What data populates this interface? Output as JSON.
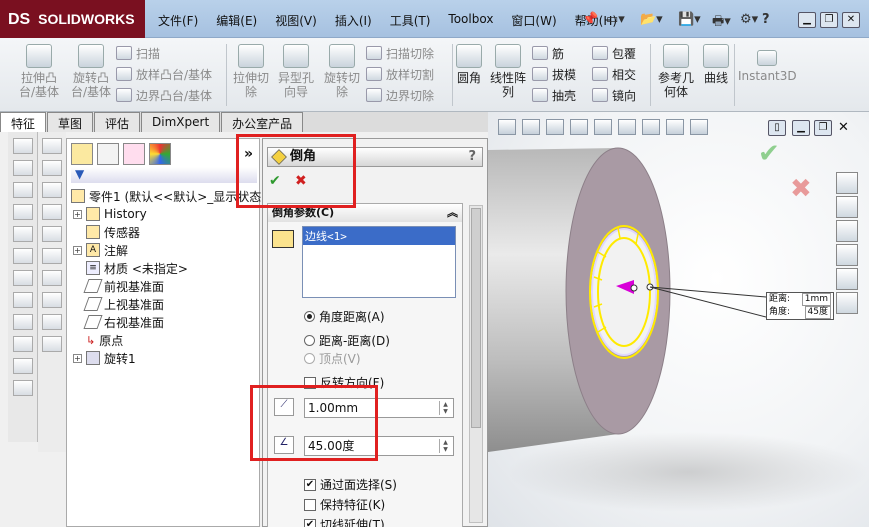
{
  "app": {
    "logo_text": "SOLIDWORKS",
    "logo_mark": "DS"
  },
  "menu": [
    "文件(F)",
    "编辑(E)",
    "视图(V)",
    "插入(I)",
    "工具(T)",
    "Toolbox",
    "窗口(W)",
    "帮助(H)"
  ],
  "quick_access": {
    "help": "?"
  },
  "ribbon": {
    "big": [
      {
        "label": "拉伸凸台/基体",
        "disabled": true
      },
      {
        "label": "旋转凸台/基体",
        "disabled": true
      },
      {
        "label": "拉伸切除",
        "disabled": true
      },
      {
        "label": "异型孔向导",
        "disabled": true
      },
      {
        "label": "旋转切除",
        "disabled": true
      },
      {
        "label": "圆角",
        "disabled": false
      },
      {
        "label": "线性阵列",
        "disabled": false
      },
      {
        "label": "参考几何体",
        "disabled": false
      },
      {
        "label": "曲线",
        "disabled": false
      },
      {
        "label": "Instant3D",
        "disabled": true
      }
    ],
    "small_col1": [
      "扫描",
      "放样凸台/基体",
      "边界凸台/基体"
    ],
    "small_col2": [
      "扫描切除",
      "放样切割",
      "边界切除"
    ],
    "small_col3": [
      "筋",
      "拔模",
      "抽壳"
    ],
    "small_col4": [
      "包覆",
      "相交",
      "镜向"
    ]
  },
  "tabs": [
    "特征",
    "草图",
    "评估",
    "DimXpert",
    "办公室产品"
  ],
  "tree": {
    "root": "零件1 (默认<<默认>_显示状态",
    "nodes": [
      {
        "label": "History",
        "expand": true
      },
      {
        "label": "传感器",
        "expand": false
      },
      {
        "label": "注解",
        "expand": true
      },
      {
        "label": "材质 <未指定>",
        "expand": false
      },
      {
        "label": "前视基准面",
        "expand": false
      },
      {
        "label": "上视基准面",
        "expand": false
      },
      {
        "label": "右视基准面",
        "expand": false
      },
      {
        "label": "原点",
        "expand": false
      },
      {
        "label": "旋转1",
        "expand": true
      }
    ]
  },
  "pm": {
    "title": "倒角",
    "help": "?",
    "ok": "✔",
    "cancel": "✖",
    "group_title": "倒角参数(C)",
    "edge_item": "边线<1>",
    "options": {
      "angle_distance": "角度距离(A)",
      "distance_distance": "距离-距离(D)",
      "vertex": "顶点(V)"
    },
    "reverse": "反转方向(F)",
    "distance_value": "1.00mm",
    "angle_value": "45.00度",
    "select_through": "通过面选择(S)",
    "keep_features": "保持特征(K)",
    "tangent_propagation": "切线延伸(T)"
  },
  "callout": {
    "distance_label": "距离:",
    "distance_value": "1mm",
    "angle_label": "角度:",
    "angle_value": "45度"
  },
  "colors": {
    "accent_red": "#e02020",
    "selection_blue": "#3b6cc8",
    "ok_green": "#2f9a2f",
    "cancel_red": "#d02020"
  }
}
